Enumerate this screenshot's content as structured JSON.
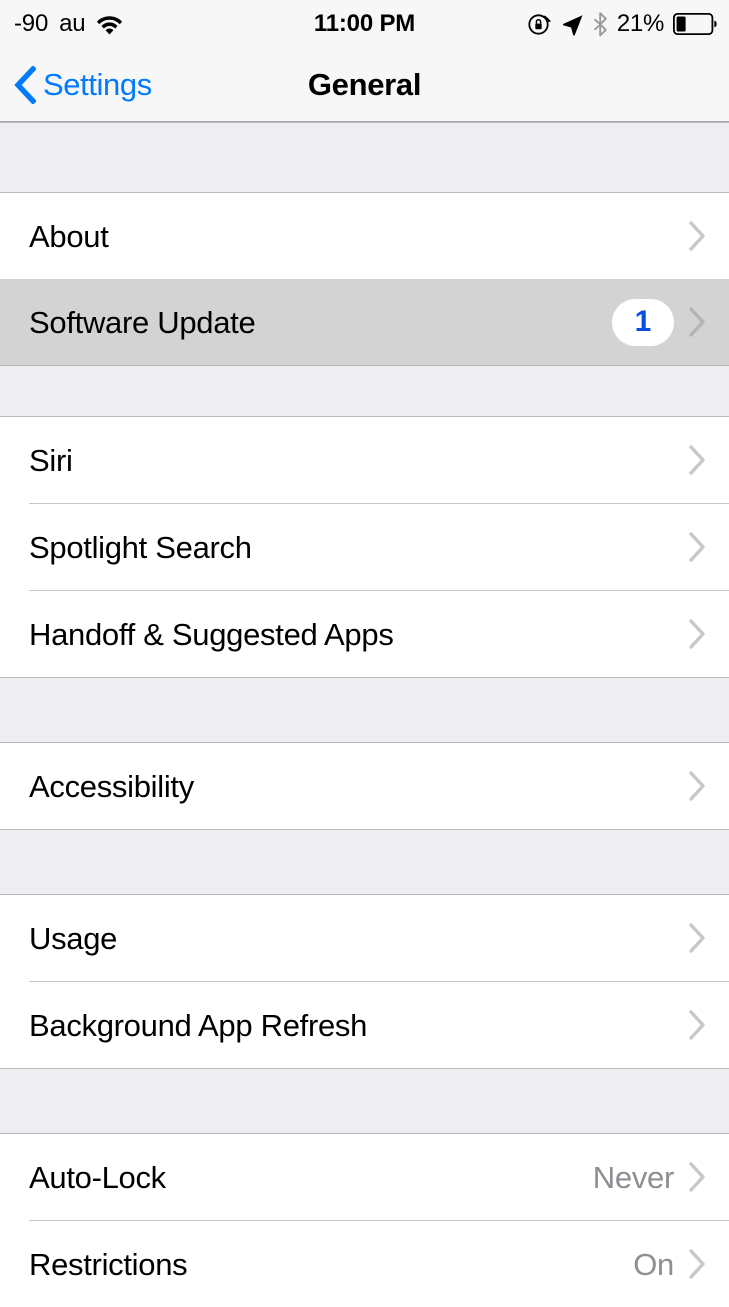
{
  "status_bar": {
    "signal_text": "-90",
    "carrier": "au",
    "wifi_icon": "wifi-icon",
    "time": "11:00 PM",
    "rotation_lock_icon": "rotation-lock-icon",
    "location_icon": "location-arrow-icon",
    "bluetooth_icon": "bluetooth-icon",
    "battery_percent": "21%",
    "battery_icon": "battery-icon",
    "battery_level": 21
  },
  "nav_bar": {
    "back_label": "Settings",
    "back_chevron_icon": "chevron-left-icon",
    "title": "General"
  },
  "colors": {
    "tint_blue": "#007aff",
    "badge_blue": "#0a50e0",
    "value_gray": "#8e8e93",
    "chevron_gray": "#c7c7cc",
    "group_bg": "#eeeef2",
    "pressed_bg": "#d3d3d4",
    "bar_bg": "#f7f7f7"
  },
  "groups": [
    {
      "rows": [
        {
          "label": "About",
          "value": "",
          "badge": "",
          "pressed": false,
          "chevron_icon": "chevron-right-icon"
        },
        {
          "label": "Software Update",
          "value": "",
          "badge": "1",
          "pressed": true,
          "chevron_icon": "chevron-right-icon"
        }
      ]
    },
    {
      "rows": [
        {
          "label": "Siri",
          "value": "",
          "badge": "",
          "pressed": false,
          "chevron_icon": "chevron-right-icon"
        },
        {
          "label": "Spotlight Search",
          "value": "",
          "badge": "",
          "pressed": false,
          "chevron_icon": "chevron-right-icon"
        },
        {
          "label": "Handoff & Suggested Apps",
          "value": "",
          "badge": "",
          "pressed": false,
          "chevron_icon": "chevron-right-icon"
        }
      ]
    },
    {
      "rows": [
        {
          "label": "Accessibility",
          "value": "",
          "badge": "",
          "pressed": false,
          "chevron_icon": "chevron-right-icon"
        }
      ]
    },
    {
      "rows": [
        {
          "label": "Usage",
          "value": "",
          "badge": "",
          "pressed": false,
          "chevron_icon": "chevron-right-icon"
        },
        {
          "label": "Background App Refresh",
          "value": "",
          "badge": "",
          "pressed": false,
          "chevron_icon": "chevron-right-icon"
        }
      ]
    },
    {
      "rows": [
        {
          "label": "Auto-Lock",
          "value": "Never",
          "badge": "",
          "pressed": false,
          "chevron_icon": "chevron-right-icon"
        },
        {
          "label": "Restrictions",
          "value": "On",
          "badge": "",
          "pressed": false,
          "chevron_icon": "chevron-right-icon"
        }
      ]
    }
  ]
}
